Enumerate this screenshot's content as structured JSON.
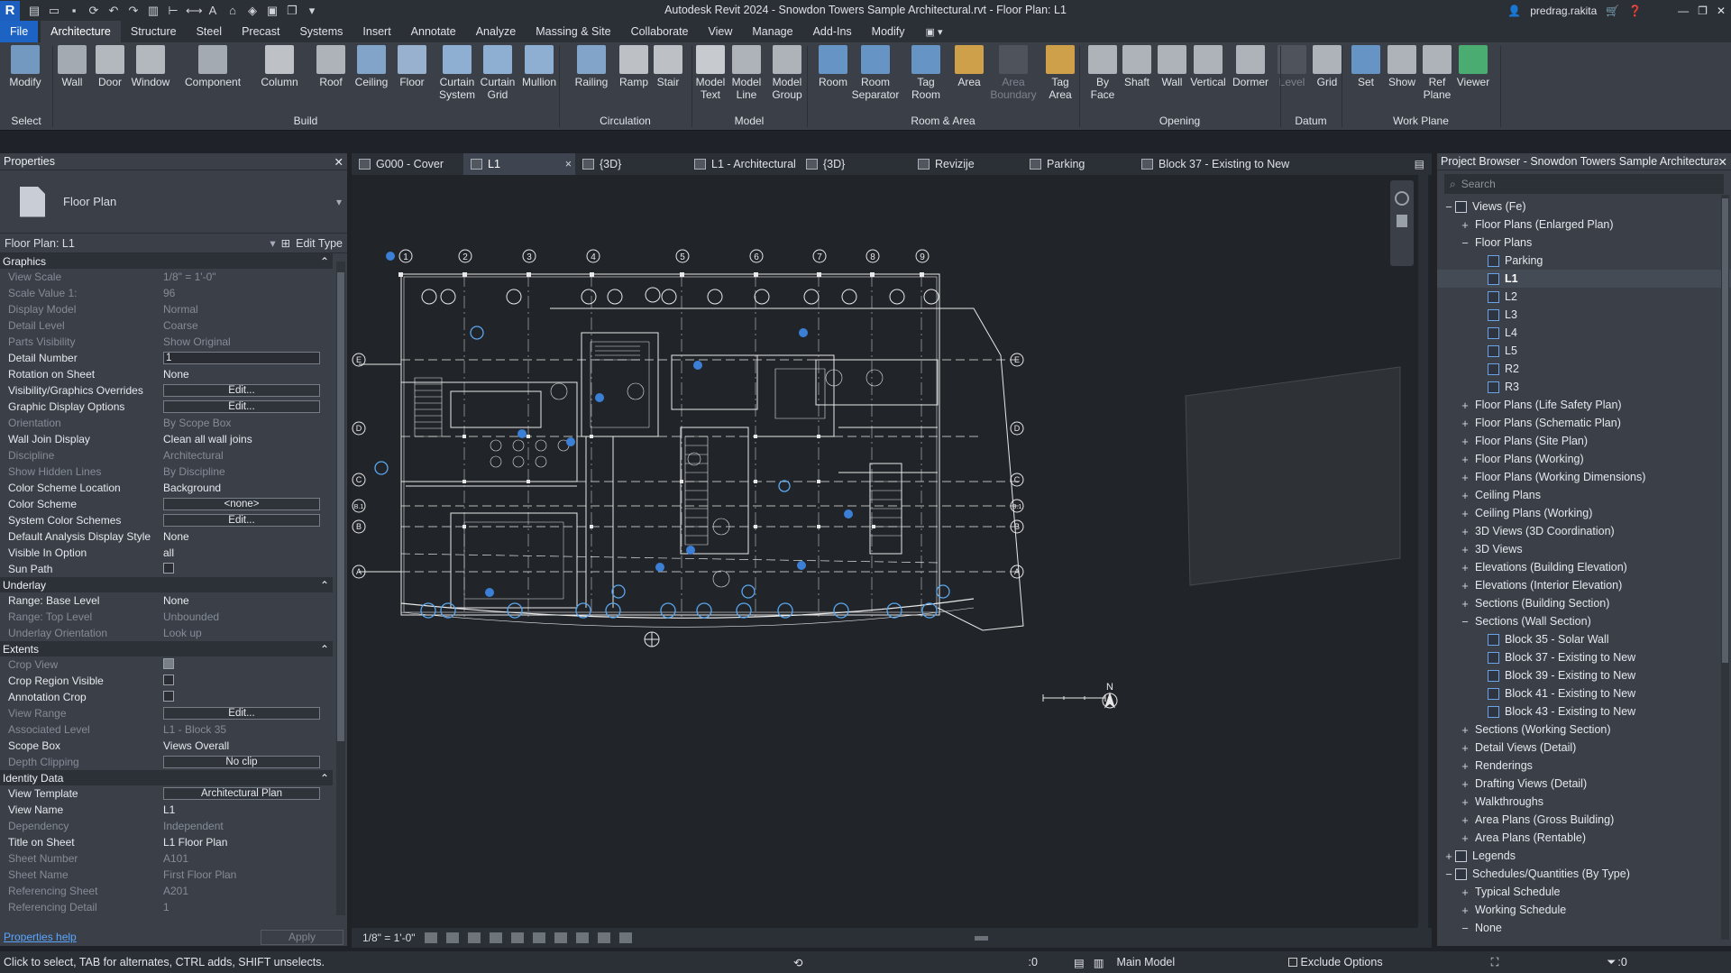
{
  "window": {
    "title": "Autodesk Revit 2024 - Snowdon Towers Sample Architectural.rvt - Floor Plan: L1",
    "user": "predrag.rakita",
    "app_letter": "R"
  },
  "ribbon_tabs": [
    "File",
    "Architecture",
    "Structure",
    "Steel",
    "Precast",
    "Systems",
    "Insert",
    "Annotate",
    "Analyze",
    "Massing & Site",
    "Collaborate",
    "View",
    "Manage",
    "Add-Ins",
    "Modify"
  ],
  "ribbon": {
    "buttons": [
      {
        "label": "Modify",
        "icon": "cursor-icon",
        "color": "#7fa9d6"
      },
      {
        "label": "Wall",
        "icon": "wall-icon",
        "color": "#b7bdc6"
      },
      {
        "label": "Door",
        "icon": "door-icon",
        "color": "#c9cdd3"
      },
      {
        "label": "Window",
        "icon": "window-icon",
        "color": "#c9cdd3"
      },
      {
        "label": "Component",
        "icon": "component-icon",
        "color": "#b7bdc6"
      },
      {
        "label": "Column",
        "icon": "column-icon",
        "color": "#d6d9de"
      },
      {
        "label": "Roof",
        "icon": "roof-icon",
        "color": "#c3c8cf"
      },
      {
        "label": "Ceiling",
        "icon": "ceiling-icon",
        "color": "#8fb6e0"
      },
      {
        "label": "Floor",
        "icon": "floor-icon",
        "color": "#a9c5e8"
      },
      {
        "label": "Curtain\nSystem",
        "icon": "curtain-system-icon",
        "color": "#9ec3ea"
      },
      {
        "label": "Curtain\nGrid",
        "icon": "curtain-grid-icon",
        "color": "#9ec3ea"
      },
      {
        "label": "Mullion",
        "icon": "mullion-icon",
        "color": "#9ec3ea"
      },
      {
        "label": "Railing",
        "icon": "railing-icon",
        "color": "#8fb6e0"
      },
      {
        "label": "Ramp",
        "icon": "ramp-icon",
        "color": "#d5d8dd"
      },
      {
        "label": "Stair",
        "icon": "stair-icon",
        "color": "#d5d8dd"
      },
      {
        "label": "Model\nText",
        "icon": "model-text-icon",
        "color": "#e0e3e8"
      },
      {
        "label": "Model\nLine",
        "icon": "model-line-icon",
        "color": "#c3c8cf"
      },
      {
        "label": "Model\nGroup",
        "icon": "model-group-icon",
        "color": "#c3c8cf"
      },
      {
        "label": "Room",
        "icon": "room-icon",
        "color": "#6ea3dc"
      },
      {
        "label": "Room\nSeparator",
        "icon": "room-separator-icon",
        "color": "#6ea3dc"
      },
      {
        "label": "Tag\nRoom",
        "icon": "tag-room-icon",
        "color": "#6ea3dc"
      },
      {
        "label": "Area",
        "icon": "area-icon",
        "color": "#e8b24a"
      },
      {
        "label": "Area\nBoundary",
        "icon": "area-boundary-icon",
        "color": "#6b6f75",
        "disabled": true
      },
      {
        "label": "Tag\nArea",
        "icon": "tag-area-icon",
        "color": "#e8b24a"
      },
      {
        "label": "By\nFace",
        "icon": "by-face-icon",
        "color": "#c3c8cf"
      },
      {
        "label": "Shaft",
        "icon": "shaft-icon",
        "color": "#c3c8cf"
      },
      {
        "label": "Wall",
        "icon": "wall-opening-icon",
        "color": "#c3c8cf"
      },
      {
        "label": "Vertical",
        "icon": "vertical-opening-icon",
        "color": "#c3c8cf"
      },
      {
        "label": "Dormer",
        "icon": "dormer-icon",
        "color": "#c3c8cf"
      },
      {
        "label": "Level",
        "icon": "level-icon",
        "color": "#6b6f75",
        "disabled": true
      },
      {
        "label": "Grid",
        "icon": "grid-icon",
        "color": "#c3c8cf"
      },
      {
        "label": "Set",
        "icon": "set-icon",
        "color": "#6ea3dc"
      },
      {
        "label": "Show",
        "icon": "show-icon",
        "color": "#c3c8cf"
      },
      {
        "label": "Ref\nPlane",
        "icon": "ref-plane-icon",
        "color": "#c3c8cf"
      },
      {
        "label": "Viewer",
        "icon": "viewer-icon",
        "color": "#4fc07a"
      }
    ],
    "panels": [
      "Select",
      "Build",
      "Circulation",
      "Model",
      "Room & Area",
      "Opening",
      "Datum",
      "Work Plane"
    ]
  },
  "properties": {
    "title": "Properties",
    "type_name": "Floor Plan",
    "instance": "Floor Plan: L1",
    "edit_type": "Edit Type",
    "groups": [
      {
        "name": "Graphics",
        "rows": [
          {
            "k": "View Scale",
            "v": "1/8\" = 1'-0\"",
            "dim": true
          },
          {
            "k": "Scale Value    1:",
            "v": "96",
            "dim": true
          },
          {
            "k": "Display Model",
            "v": "Normal",
            "dim": true
          },
          {
            "k": "Detail Level",
            "v": "Coarse",
            "dim": true
          },
          {
            "k": "Parts Visibility",
            "v": "Show Original",
            "dim": true
          },
          {
            "k": "Detail Number",
            "v": "1",
            "box": true
          },
          {
            "k": "Rotation on Sheet",
            "v": "None"
          },
          {
            "k": "Visibility/Graphics Overrides",
            "v": "Edit...",
            "btn": true
          },
          {
            "k": "Graphic Display Options",
            "v": "Edit...",
            "btn": true
          },
          {
            "k": "Orientation",
            "v": "By Scope Box",
            "dim": true
          },
          {
            "k": "Wall Join Display",
            "v": "Clean all wall joins"
          },
          {
            "k": "Discipline",
            "v": "Architectural",
            "dim": true
          },
          {
            "k": "Show Hidden Lines",
            "v": "By Discipline",
            "dim": true
          },
          {
            "k": "Color Scheme Location",
            "v": "Background"
          },
          {
            "k": "Color Scheme",
            "v": "<none>",
            "btn": true
          },
          {
            "k": "System Color Schemes",
            "v": "Edit...",
            "btn": true
          },
          {
            "k": "Default Analysis Display Style",
            "v": "None"
          },
          {
            "k": "Visible In Option",
            "v": "all"
          },
          {
            "k": "Sun Path",
            "v": "",
            "chk": true
          }
        ]
      },
      {
        "name": "Underlay",
        "rows": [
          {
            "k": "Range: Base Level",
            "v": "None"
          },
          {
            "k": "Range: Top Level",
            "v": "Unbounded",
            "dim": true
          },
          {
            "k": "Underlay Orientation",
            "v": "Look up",
            "dim": true
          }
        ]
      },
      {
        "name": "Extents",
        "rows": [
          {
            "k": "Crop View",
            "v": "",
            "chk": true,
            "on": true,
            "dim": true
          },
          {
            "k": "Crop Region Visible",
            "v": "",
            "chk": true
          },
          {
            "k": "Annotation Crop",
            "v": "",
            "chk": true
          },
          {
            "k": "View Range",
            "v": "Edit...",
            "btn": true,
            "dim": true
          },
          {
            "k": "Associated Level",
            "v": "L1 - Block 35",
            "dim": true
          },
          {
            "k": "Scope Box",
            "v": "Views Overall"
          },
          {
            "k": "Depth Clipping",
            "v": "No clip",
            "btn": true,
            "dim": true
          }
        ]
      },
      {
        "name": "Identity Data",
        "rows": [
          {
            "k": "View Template",
            "v": "Architectural Plan",
            "btn": true
          },
          {
            "k": "View Name",
            "v": "L1"
          },
          {
            "k": "Dependency",
            "v": "Independent",
            "dim": true
          },
          {
            "k": "Title on Sheet",
            "v": "L1 Floor Plan"
          },
          {
            "k": "Sheet Number",
            "v": "A101",
            "dim": true
          },
          {
            "k": "Sheet Name",
            "v": "First Floor Plan",
            "dim": true
          },
          {
            "k": "Referencing Sheet",
            "v": "A201",
            "dim": true
          },
          {
            "k": "Referencing Detail",
            "v": "1",
            "dim": true
          }
        ]
      }
    ],
    "help_link": "Properties help",
    "apply": "Apply"
  },
  "view_tabs": [
    {
      "label": "G000 - Cover"
    },
    {
      "label": "L1",
      "active": true,
      "close": "×"
    },
    {
      "label": "{3D}"
    },
    {
      "label": "L1 - Architectural"
    },
    {
      "label": "{3D}"
    },
    {
      "label": "Revizije"
    },
    {
      "label": "Parking"
    },
    {
      "label": "Block 37 - Existing to New"
    }
  ],
  "view_control": {
    "scale": "1/8\" = 1'-0\""
  },
  "grid_labels": {
    "columns": [
      "1",
      "2",
      "3",
      "4",
      "5",
      "6",
      "7",
      "8",
      "9"
    ],
    "rows": [
      "E",
      "D",
      "C",
      "B.1",
      "B",
      "A"
    ],
    "north": "N"
  },
  "project_browser": {
    "title": "Project Browser - Snowdon Towers Sample Architectural...",
    "search_placeholder": "Search",
    "items": [
      {
        "label": "Views (Fe)",
        "depth": 0,
        "tog": "−",
        "icon": true
      },
      {
        "label": "Floor Plans (Enlarged Plan)",
        "depth": 1,
        "tog": "+"
      },
      {
        "label": "Floor Plans",
        "depth": 1,
        "tog": "−"
      },
      {
        "label": "Parking",
        "depth": 2,
        "icon": true
      },
      {
        "label": "L1",
        "depth": 2,
        "icon": true,
        "sel": true
      },
      {
        "label": "L2",
        "depth": 2,
        "icon": true
      },
      {
        "label": "L3",
        "depth": 2,
        "icon": true
      },
      {
        "label": "L4",
        "depth": 2,
        "icon": true
      },
      {
        "label": "L5",
        "depth": 2,
        "icon": true
      },
      {
        "label": "R2",
        "depth": 2,
        "icon": true
      },
      {
        "label": "R3",
        "depth": 2,
        "icon": true
      },
      {
        "label": "Floor Plans (Life Safety Plan)",
        "depth": 1,
        "tog": "+"
      },
      {
        "label": "Floor Plans (Schematic Plan)",
        "depth": 1,
        "tog": "+"
      },
      {
        "label": "Floor Plans (Site Plan)",
        "depth": 1,
        "tog": "+"
      },
      {
        "label": "Floor Plans (Working)",
        "depth": 1,
        "tog": "+"
      },
      {
        "label": "Floor Plans (Working Dimensions)",
        "depth": 1,
        "tog": "+"
      },
      {
        "label": "Ceiling Plans",
        "depth": 1,
        "tog": "+"
      },
      {
        "label": "Ceiling Plans (Working)",
        "depth": 1,
        "tog": "+"
      },
      {
        "label": "3D Views (3D Coordination)",
        "depth": 1,
        "tog": "+"
      },
      {
        "label": "3D Views",
        "depth": 1,
        "tog": "+"
      },
      {
        "label": "Elevations (Building Elevation)",
        "depth": 1,
        "tog": "+"
      },
      {
        "label": "Elevations (Interior Elevation)",
        "depth": 1,
        "tog": "+"
      },
      {
        "label": "Sections (Building Section)",
        "depth": 1,
        "tog": "+"
      },
      {
        "label": "Sections (Wall Section)",
        "depth": 1,
        "tog": "−"
      },
      {
        "label": "Block 35 - Solar Wall",
        "depth": 2,
        "icon": true
      },
      {
        "label": "Block 37 - Existing to New",
        "depth": 2,
        "icon": true
      },
      {
        "label": "Block 39 - Existing to New",
        "depth": 2,
        "icon": true
      },
      {
        "label": "Block 41 - Existing to New",
        "depth": 2,
        "icon": true
      },
      {
        "label": "Block 43 - Existing to New",
        "depth": 2,
        "icon": true
      },
      {
        "label": "Sections (Working Section)",
        "depth": 1,
        "tog": "+"
      },
      {
        "label": "Detail Views (Detail)",
        "depth": 1,
        "tog": "+"
      },
      {
        "label": "Renderings",
        "depth": 1,
        "tog": "+"
      },
      {
        "label": "Drafting Views (Detail)",
        "depth": 1,
        "tog": "+"
      },
      {
        "label": "Walkthroughs",
        "depth": 1,
        "tog": "+"
      },
      {
        "label": "Area Plans (Gross Building)",
        "depth": 1,
        "tog": "+"
      },
      {
        "label": "Area Plans (Rentable)",
        "depth": 1,
        "tog": "+"
      },
      {
        "label": "Legends",
        "depth": 0,
        "tog": "+",
        "icon": true
      },
      {
        "label": "Schedules/Quantities (By Type)",
        "depth": 0,
        "tog": "−",
        "icon": true
      },
      {
        "label": "Typical Schedule",
        "depth": 1,
        "tog": "+"
      },
      {
        "label": "Working Schedule",
        "depth": 1,
        "tog": "+"
      },
      {
        "label": "None",
        "depth": 1,
        "tog": "−"
      }
    ]
  },
  "status_bar": {
    "message": "Click to select, TAB for alternates, CTRL adds, SHIFT unselects.",
    "workset": ":0",
    "model": "Main Model",
    "exclude_options": "Exclude Options",
    "filter_count": ":0"
  }
}
